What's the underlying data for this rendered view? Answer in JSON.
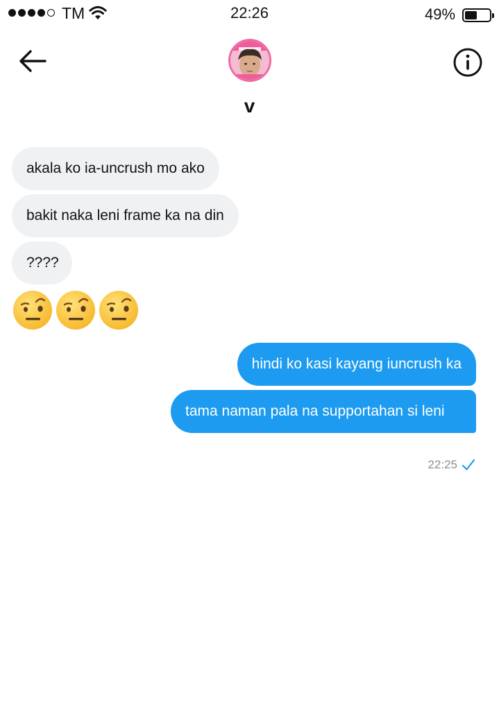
{
  "status_bar": {
    "carrier": "TM",
    "time": "22:26",
    "battery_percent": "49%",
    "battery_level": 0.49,
    "signal_bars_filled": 4,
    "signal_bars_total": 5
  },
  "header": {
    "contact_name": "v",
    "back_icon": "arrow-left-icon",
    "info_icon": "info-icon"
  },
  "messages": {
    "incoming": [
      "akala ko ia-uncrush mo ako",
      "bakit naka leni frame ka na din",
      "????"
    ],
    "emoji_count": 3,
    "emoji_name": "face-with-raised-eyebrow",
    "outgoing": [
      "hindi ko kasi kayang iuncrush ka",
      "tama naman pala na supportahan si leni"
    ],
    "sent_time": "22:25",
    "read_icon": "checkmark-icon"
  },
  "colors": {
    "outgoing_bubble": "#1d9bf0",
    "incoming_bubble": "#f0f1f3",
    "checkmark": "#1d9bf0",
    "avatar_frame": "#f06aa3"
  }
}
